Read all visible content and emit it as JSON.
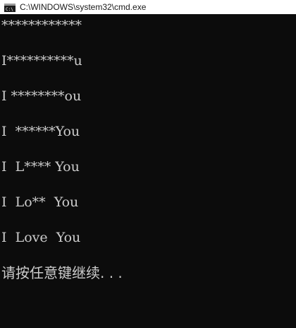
{
  "window": {
    "title": "C:\\WINDOWS\\system32\\cmd.exe",
    "icon": "cmd-console-icon"
  },
  "console": {
    "lines": [
      "************",
      "I**********u",
      "I ********ou",
      "I  ******You",
      "I  L**** You",
      "I  Lo**  You",
      "I  Love  You",
      "请按任意键继续. . ."
    ]
  },
  "colors": {
    "background": "#0c0c0c",
    "text": "#cccccc",
    "titlebar": "#ffffff"
  }
}
